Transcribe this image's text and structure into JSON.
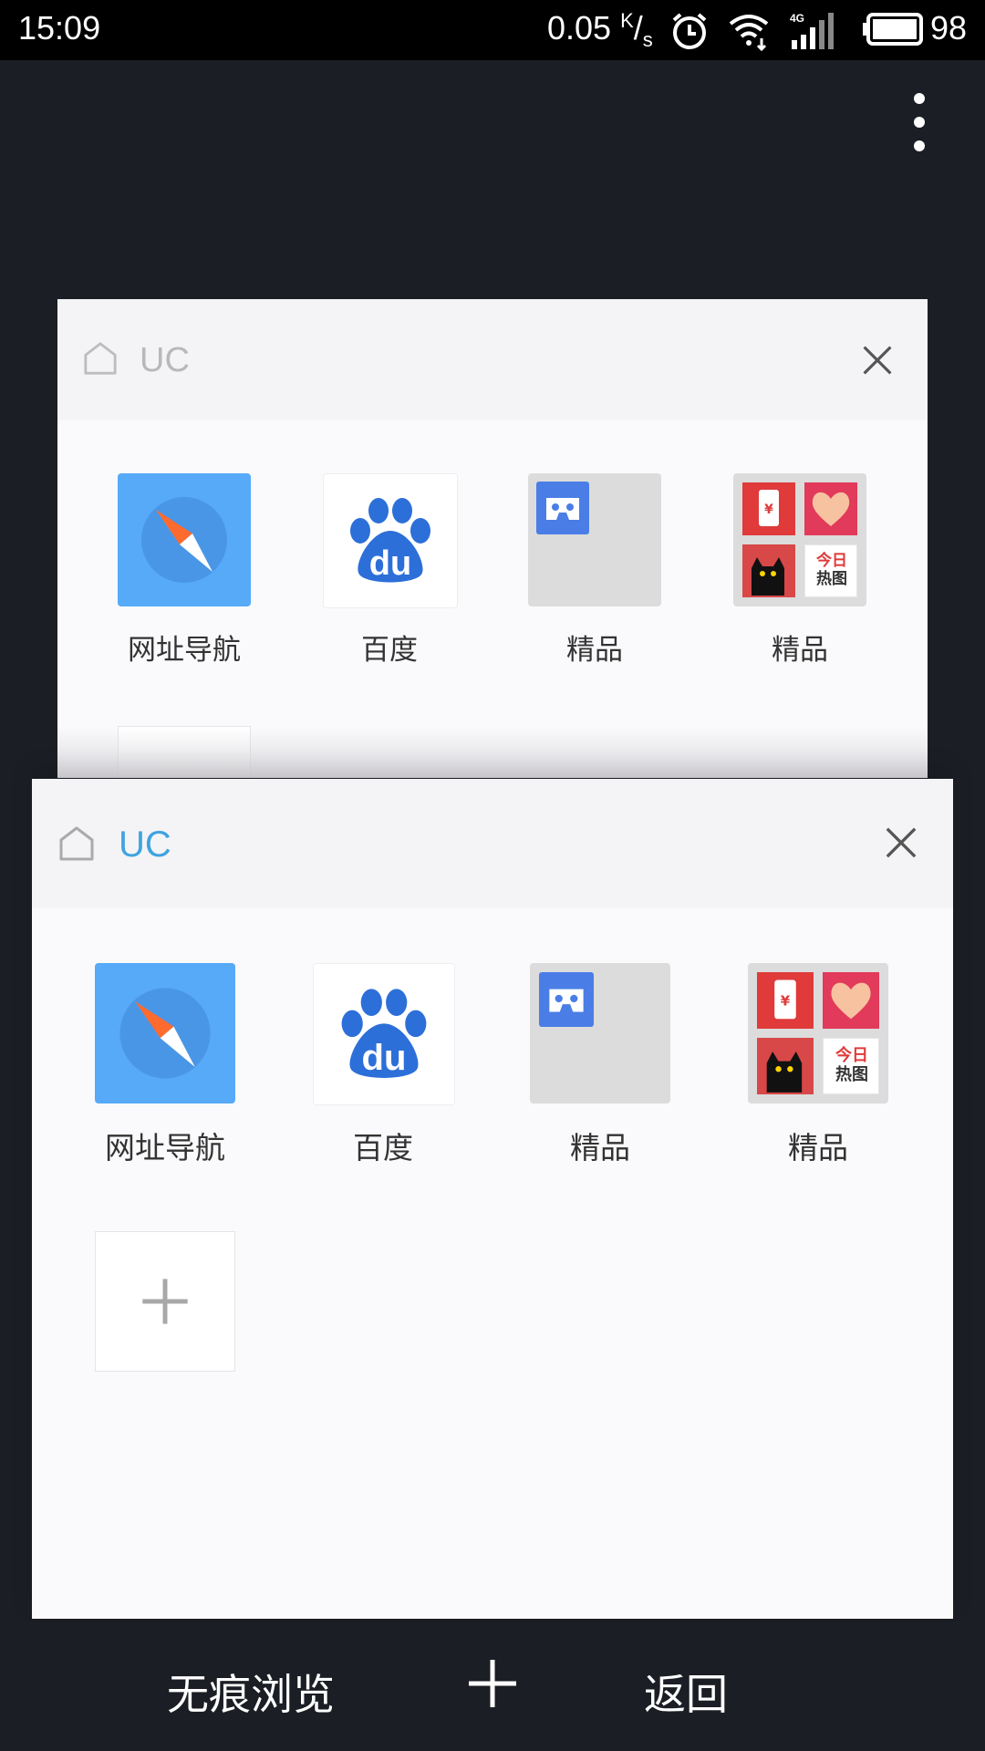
{
  "status_bar": {
    "time": "15:09",
    "net_speed": "0.05",
    "net_unit_top": "K",
    "net_unit_bottom": "s",
    "battery_percent": "98",
    "icons": [
      "alarm-icon",
      "wifi-icon",
      "signal-4g-icon",
      "battery-icon"
    ]
  },
  "overflow_menu_icon": "more-vertical-icon",
  "tabs": [
    {
      "title": "UC",
      "active": false,
      "tiles": [
        {
          "label": "网址导航",
          "icon": "compass-icon"
        },
        {
          "label": "百度",
          "icon": "baidu-paw-icon"
        },
        {
          "label": "精品",
          "icon": "vr-headset-icon"
        },
        {
          "label": "精品",
          "icon": "tmall-collage-icon"
        }
      ]
    },
    {
      "title": "UC",
      "active": true,
      "tiles": [
        {
          "label": "网址导航",
          "icon": "compass-icon"
        },
        {
          "label": "百度",
          "icon": "baidu-paw-icon"
        },
        {
          "label": "精品",
          "icon": "vr-headset-icon"
        },
        {
          "label": "精品",
          "icon": "tmall-collage-icon"
        }
      ],
      "add_tile_icon": "plus-icon"
    }
  ],
  "collage_text": {
    "line1": "今日",
    "line2": "热图",
    "yen": "¥"
  },
  "baidu_text": "du",
  "bottom_bar": {
    "incognito_label": "无痕浏览",
    "new_tab_icon": "plus-icon",
    "back_label": "返回"
  },
  "colors": {
    "background": "#1b1e24",
    "active_title": "#3fa3e0",
    "inactive_title": "#b8b8b8",
    "compass_tile": "#56aaf8",
    "baidu_blue": "#2d6fd8",
    "grey_tile": "#dcdcdc",
    "vr_tile": "#4a7ee6",
    "collage_red": "#e03a3a"
  }
}
